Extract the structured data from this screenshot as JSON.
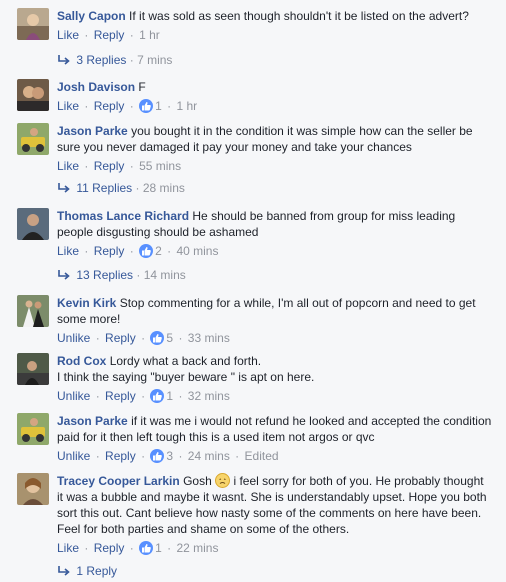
{
  "actions": {
    "like": "Like",
    "unlike": "Unlike",
    "reply": "Reply",
    "separator": "·",
    "edited": "Edited"
  },
  "comments": [
    {
      "author": "Sally Capon",
      "text": "If it was sold as seen though shouldn't it be listed on the advert?",
      "time": "1 hr",
      "replies": {
        "count": "3 Replies",
        "time": "7 mins"
      }
    },
    {
      "author": "Josh Davison",
      "text": "F",
      "reactions": "1",
      "time": "1 hr"
    },
    {
      "author": "Jason Parke",
      "text": "you bought it in the condition it was simple how can the seller be sure you never damaged it pay your money and take your chances",
      "time": "55 mins",
      "replies": {
        "count": "11 Replies",
        "time": "28 mins"
      }
    },
    {
      "author": "Thomas Lance Richard",
      "text": "He should be banned from group for miss leading people disgusting should be ashamed",
      "reactions": "2",
      "time": "40 mins",
      "replies": {
        "count": "13 Replies",
        "time": "14 mins"
      }
    },
    {
      "author": "Kevin Kirk",
      "text": "Stop commenting for a while, I'm all out of popcorn and need to get some more!",
      "reactions": "5",
      "time": "33 mins"
    },
    {
      "author": "Rod Cox",
      "text": "Lordy what a back and forth.",
      "text2": "I think the saying \"buyer beware \" is apt on here.",
      "reactions": "1",
      "time": "32 mins"
    },
    {
      "author": "Jason Parke",
      "text": "if it was me i would not refund he looked and accepted the condition paid for it then left tough this is a used item not argos or qvc",
      "reactions": "3",
      "time": "24 mins"
    },
    {
      "author": "Tracey Cooper Larkin",
      "text": "Gosh",
      "text_after_emoji": "i feel sorry for both of you. He probably thought it was a bubble and maybe it wasnt. She is understandably upset. Hope you both sort this out. Cant believe how nasty some of the comments on here have been. Feel for both parties and shame on some of the others.",
      "reactions": "1",
      "time": "22 mins",
      "replies": {
        "count": "1 Reply"
      }
    }
  ]
}
